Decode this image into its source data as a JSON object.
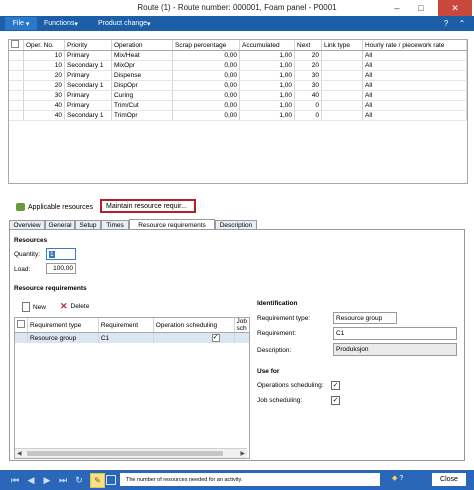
{
  "window": {
    "title": "Route (1) - Route number: 000001, Foam panel - P0001"
  },
  "menubar": {
    "file": "File",
    "functions": "Functions",
    "product_change": "Product change"
  },
  "grid": {
    "columns": [
      "Oper. No.",
      "Priority",
      "Operation",
      "Scrap percentage",
      "Accumulated",
      "Next",
      "Link type",
      "Hourly rate / piecework rate"
    ],
    "rows": [
      [
        "10",
        "Primary",
        "Mix/Heat",
        "0,00",
        "1,00",
        "20",
        "",
        "All"
      ],
      [
        "10",
        "Secondary 1",
        "MixOpr",
        "0,00",
        "1,00",
        "20",
        "",
        "All"
      ],
      [
        "20",
        "Primary",
        "Dispense",
        "0,00",
        "1,00",
        "30",
        "",
        "All"
      ],
      [
        "20",
        "Secondary 1",
        "DispOpr",
        "0,00",
        "1,00",
        "30",
        "",
        "All"
      ],
      [
        "30",
        "Primary",
        "Curing",
        "0,00",
        "1,00",
        "40",
        "",
        "All"
      ],
      [
        "40",
        "Primary",
        "Trim/Cut",
        "0,00",
        "1,00",
        "0",
        "",
        "All"
      ],
      [
        "40",
        "Secondary 1",
        "TrimOpr",
        "0,00",
        "1,00",
        "0",
        "",
        "All"
      ]
    ]
  },
  "actions": {
    "applicable_resources": "Applicable resources",
    "maintain_resource_req": "Maintain resource requir..."
  },
  "tabs": [
    "Overview",
    "General",
    "Setup",
    "Times",
    "Resource requirements",
    "Description"
  ],
  "resources": {
    "heading": "Resources",
    "quantity_label": "Quantity:",
    "quantity_value": "1",
    "load_label": "Load:",
    "load_value": "100,00"
  },
  "resource_requirements": {
    "heading": "Resource requirements",
    "new": "New",
    "delete": "Delete",
    "columns": [
      "Requirement type",
      "Requirement",
      "Operation scheduling",
      "Job sch"
    ],
    "rows": [
      [
        "Resource group",
        "C1",
        true,
        ""
      ]
    ]
  },
  "identification": {
    "heading": "Identification",
    "type_label": "Requirement type:",
    "type_value": "Resource group",
    "req_label": "Requirement:",
    "req_value": "C1",
    "desc_label": "Description:",
    "desc_value": "Produksjon"
  },
  "use_for": {
    "heading": "Use for",
    "op_label": "Operations scheduling:",
    "job_label": "Job scheduling:"
  },
  "statusbar": {
    "message": "The number of resources needed for an activity.",
    "close": "Close",
    "help_hint": "?"
  }
}
